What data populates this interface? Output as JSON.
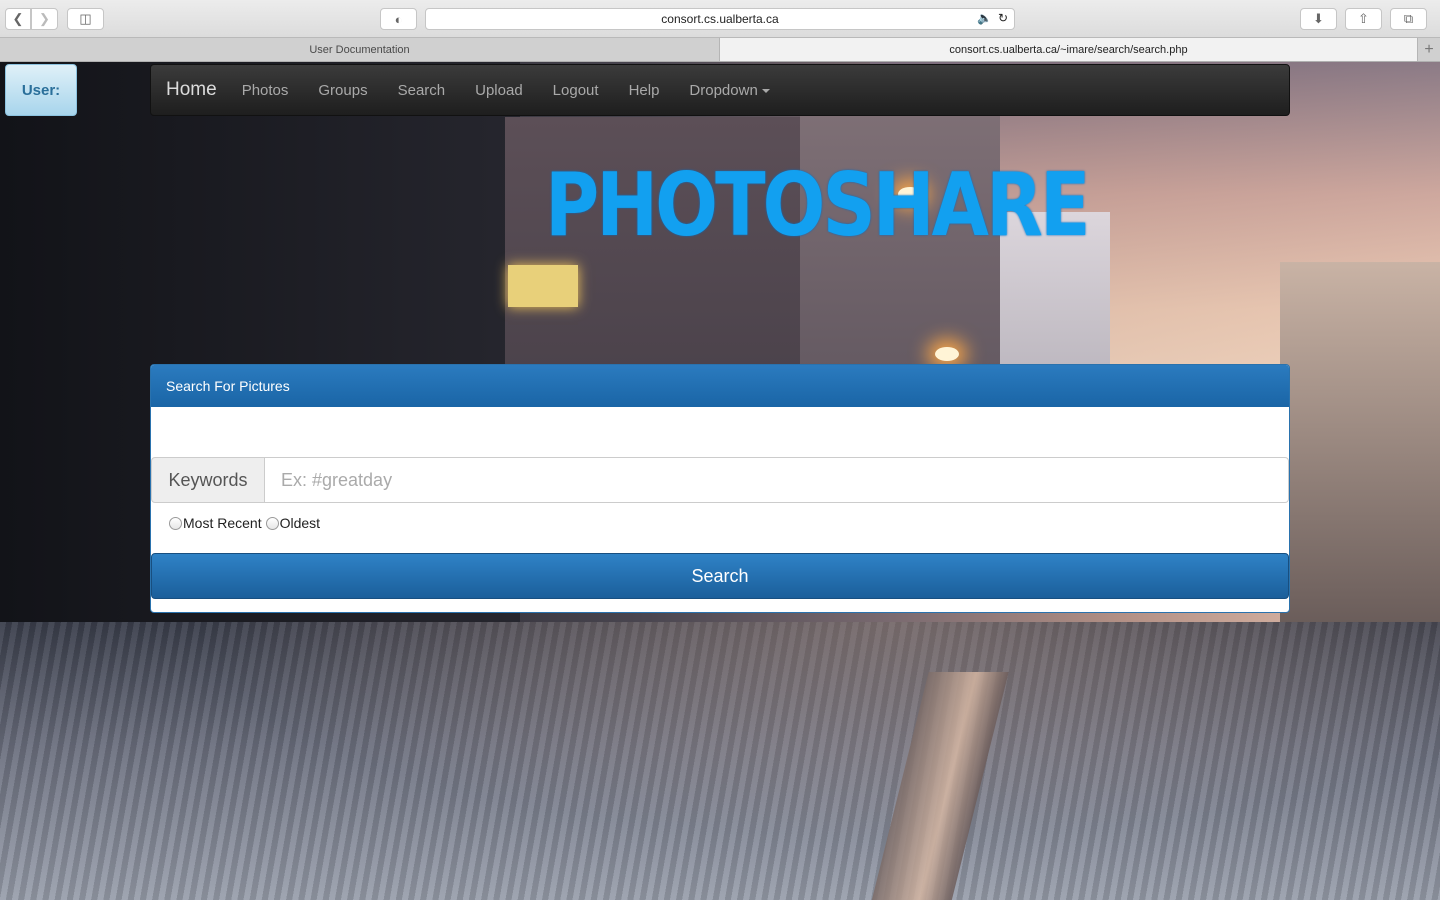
{
  "browser": {
    "address": "consort.cs.ualberta.ca",
    "tabs": [
      {
        "label": "User Documentation"
      },
      {
        "label": "consort.cs.ualberta.ca/~imare/search/search.php"
      }
    ]
  },
  "user": {
    "label": "User:"
  },
  "nav": {
    "brand": "Home",
    "items": [
      "Photos",
      "Groups",
      "Search",
      "Upload",
      "Logout",
      "Help",
      "Dropdown"
    ]
  },
  "logo": {
    "text": "PHOTOSHARE"
  },
  "panel": {
    "heading": "Search For Pictures",
    "keywords_label": "Keywords",
    "keywords_placeholder": "Ex: #greatday",
    "keywords_value": "",
    "sort_options": [
      "Most Recent",
      "Oldest"
    ],
    "search_button": "Search"
  },
  "colors": {
    "accent": "#1a65a6",
    "logo": "#12a0f0",
    "navbar": "#222222"
  }
}
